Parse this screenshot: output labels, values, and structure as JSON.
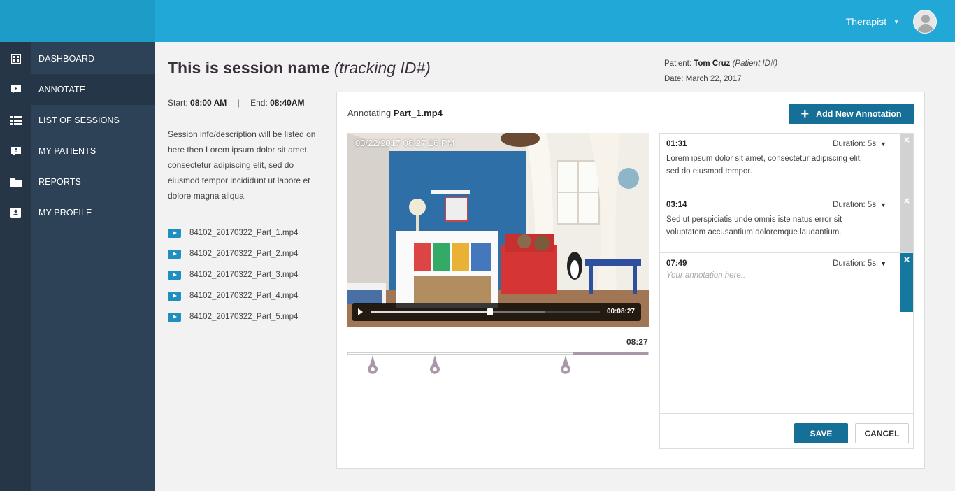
{
  "header": {
    "user_name": "Therapist",
    "user_caret": "▼"
  },
  "sidebar": {
    "items": [
      {
        "label": "DASHBOARD",
        "icon": "dashboard-icon"
      },
      {
        "label": "ANNOTATE",
        "icon": "annotate-icon",
        "active": true
      },
      {
        "label": "LIST OF SESSIONS",
        "icon": "list-icon"
      },
      {
        "label": "MY PATIENTS",
        "icon": "patients-icon"
      },
      {
        "label": "REPORTS",
        "icon": "folder-icon"
      },
      {
        "label": "MY PROFILE",
        "icon": "profile-icon"
      }
    ]
  },
  "session": {
    "name": "This is session name",
    "tracking": "(tracking ID#)",
    "start_label": "Start:",
    "start_value": "08:00 AM",
    "separator": "|",
    "end_label": "End:",
    "end_value": "08:40AM",
    "description": "Session info/description will be listed on here then Lorem ipsum dolor sit amet, consectetur adipiscing elit, sed do eiusmod tempor incididunt ut labore et dolore magna aliqua.",
    "files": [
      "84102_20170322_Part_1.mp4",
      "84102_20170322_Part_2.mp4",
      "84102_20170322_Part_3.mp4",
      "84102_20170322_Part_4.mp4",
      "84102_20170322_Part_5.mp4"
    ]
  },
  "patient": {
    "label": "Patient:",
    "name": "Tom Cruz",
    "id_text": "(Patient ID#)",
    "date_label": "Date:",
    "date_value": "March 22, 2017"
  },
  "annotate": {
    "prefix": "Annotating",
    "file": "Part_1.mp4",
    "add_button": "Add New Annotation",
    "video": {
      "timestamp_overlay": "03/22/2017 08:27:16 PM",
      "current_time": "00:08:27",
      "progress_fraction": 0.52,
      "buffer_fraction": 0.76
    },
    "timeline": {
      "time": "08:27",
      "fill_start_fraction": 0.75
    },
    "annotations": [
      {
        "time": "01:31",
        "duration": "Duration: 5s",
        "text": "Lorem ipsum dolor sit amet, consectetur adipiscing elit, sed do eiusmod tempor."
      },
      {
        "time": "03:14",
        "duration": "Duration: 5s",
        "text": "Sed ut perspiciatis unde omnis iste natus error sit voluptatem accusantium doloremque laudantium."
      },
      {
        "time": "07:49",
        "duration": "Duration: 5s",
        "placeholder": "Your annotation here.."
      }
    ],
    "close_symbol": "×",
    "save_label": "SAVE",
    "cancel_label": "CANCEL",
    "colors": {
      "primary": "#166f96",
      "topbar": "#22a8d6",
      "sidebar": "#2e4257",
      "marker": "#a898a8"
    }
  }
}
